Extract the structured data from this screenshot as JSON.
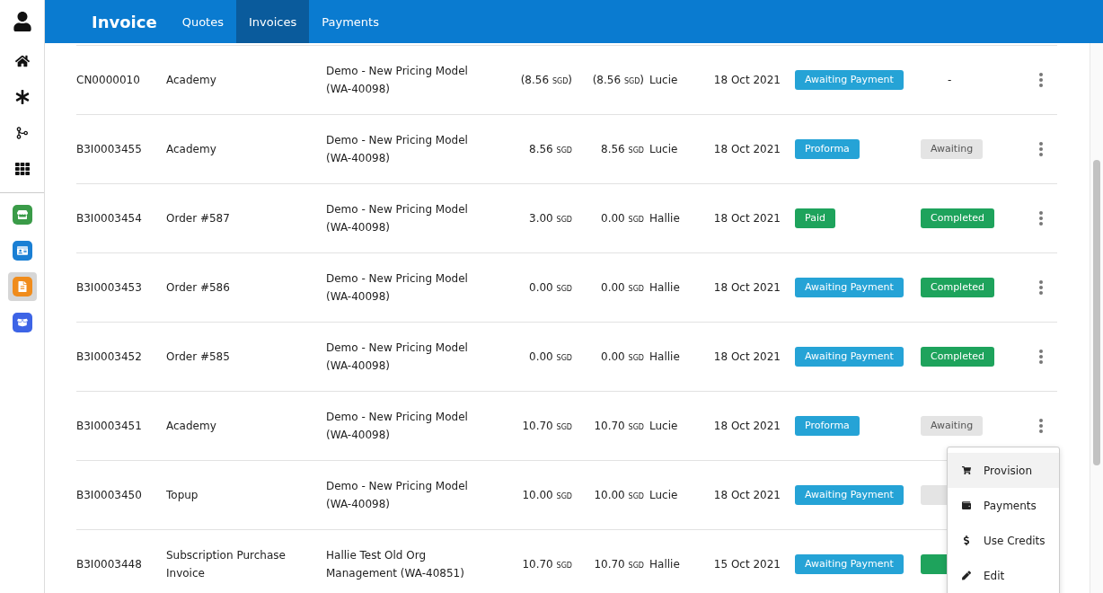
{
  "sidebar": {
    "apps": [
      {
        "color": "#3a9b48",
        "selected": false
      },
      {
        "color": "#1a7fd4",
        "selected": false
      },
      {
        "color": "#f08c1c",
        "selected": true
      },
      {
        "color": "#3d64e6",
        "selected": false
      }
    ]
  },
  "header": {
    "title": "Invoice",
    "tabs": [
      {
        "label": "Quotes",
        "selected": false
      },
      {
        "label": "Invoices",
        "selected": true
      },
      {
        "label": "Payments",
        "selected": false
      }
    ]
  },
  "table": {
    "rows": [
      {
        "id": "CN0000010",
        "order": "Academy",
        "project": "Demo - New Pricing Model (WA-40098)",
        "amount": {
          "number": "(8.56",
          "currency": "SGD",
          "close": ")"
        },
        "balance": {
          "number": "(8.56",
          "currency": "SGD",
          "close": ")"
        },
        "user": "Lucie",
        "date": "18 Oct 2021",
        "status": {
          "kind": "awaiting",
          "label": "Awaiting Payment"
        },
        "fulfilment": {
          "kind": "none",
          "label": "-"
        }
      },
      {
        "id": "B3I0003455",
        "order": "Academy",
        "project": "Demo - New Pricing Model (WA-40098)",
        "amount": {
          "number": "8.56",
          "currency": "SGD"
        },
        "balance": {
          "number": "8.56",
          "currency": "SGD"
        },
        "user": "Lucie",
        "date": "18 Oct 2021",
        "status": {
          "kind": "proforma",
          "label": "Proforma"
        },
        "fulfilment": {
          "kind": "awaiting",
          "label": "Awaiting"
        }
      },
      {
        "id": "B3I0003454",
        "order": "Order #587",
        "project": "Demo - New Pricing Model (WA-40098)",
        "amount": {
          "number": "3.00",
          "currency": "SGD"
        },
        "balance": {
          "number": "0.00",
          "currency": "SGD"
        },
        "user": "Hallie",
        "date": "18 Oct 2021",
        "status": {
          "kind": "paid",
          "label": "Paid"
        },
        "fulfilment": {
          "kind": "completed",
          "label": "Completed"
        }
      },
      {
        "id": "B3I0003453",
        "order": "Order #586",
        "project": "Demo - New Pricing Model (WA-40098)",
        "amount": {
          "number": "0.00",
          "currency": "SGD"
        },
        "balance": {
          "number": "0.00",
          "currency": "SGD"
        },
        "user": "Hallie",
        "date": "18 Oct 2021",
        "status": {
          "kind": "awaiting",
          "label": "Awaiting Payment"
        },
        "fulfilment": {
          "kind": "completed",
          "label": "Completed"
        }
      },
      {
        "id": "B3I0003452",
        "order": "Order #585",
        "project": "Demo - New Pricing Model (WA-40098)",
        "amount": {
          "number": "0.00",
          "currency": "SGD"
        },
        "balance": {
          "number": "0.00",
          "currency": "SGD"
        },
        "user": "Hallie",
        "date": "18 Oct 2021",
        "status": {
          "kind": "awaiting",
          "label": "Awaiting Payment"
        },
        "fulfilment": {
          "kind": "completed",
          "label": "Completed"
        }
      },
      {
        "id": "B3I0003451",
        "order": "Academy",
        "project": "Demo - New Pricing Model (WA-40098)",
        "amount": {
          "number": "10.70",
          "currency": "SGD"
        },
        "balance": {
          "number": "10.70",
          "currency": "SGD"
        },
        "user": "Lucie",
        "date": "18 Oct 2021",
        "status": {
          "kind": "proforma",
          "label": "Proforma"
        },
        "fulfilment": {
          "kind": "awaiting",
          "label": "Awaiting"
        }
      },
      {
        "id": "B3I0003450",
        "order": "Topup",
        "project": "Demo - New Pricing Model (WA-40098)",
        "amount": {
          "number": "10.00",
          "currency": "SGD"
        },
        "balance": {
          "number": "10.00",
          "currency": "SGD"
        },
        "user": "Lucie",
        "date": "18 Oct 2021",
        "status": {
          "kind": "awaiting",
          "label": "Awaiting Payment"
        },
        "fulfilment": {
          "kind": "awaiting"
        }
      },
      {
        "id": "B3I0003448",
        "order": "Subscription Purchase Invoice",
        "project": "Hallie Test Old Org Management (WA-40851)",
        "amount": {
          "number": "10.70",
          "currency": "SGD"
        },
        "balance": {
          "number": "10.70",
          "currency": "SGD"
        },
        "user": "Hallie",
        "date": "15 Oct 2021",
        "status": {
          "kind": "awaiting",
          "label": "Awaiting Payment"
        },
        "fulfilment": {
          "kind": "completed"
        }
      }
    ]
  },
  "row_menu": {
    "items": [
      {
        "label": "Provision",
        "selected": true
      },
      {
        "label": "Payments",
        "selected": false
      },
      {
        "label": "Use Credits",
        "selected": false
      },
      {
        "label": "Edit",
        "selected": false
      }
    ]
  }
}
